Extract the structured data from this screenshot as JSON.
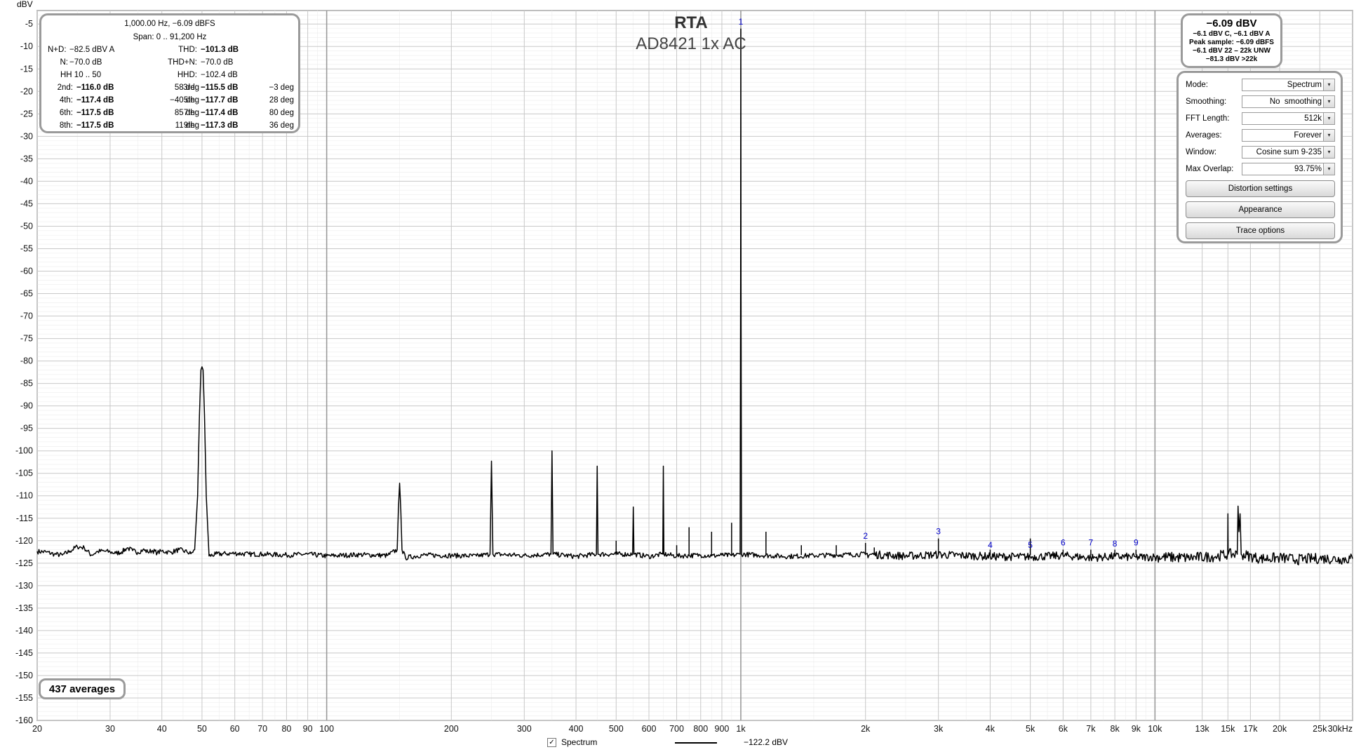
{
  "chart_data": {
    "type": "line",
    "title": "RTA",
    "subtitle": "AD8421 1x AC",
    "ylabel": "dBV",
    "xscale": "log",
    "xlim": [
      20,
      30000
    ],
    "ylim": [
      -160,
      -2
    ],
    "y_ticks": [
      -5,
      -10,
      -15,
      -20,
      -25,
      -30,
      -35,
      -40,
      -45,
      -50,
      -55,
      -60,
      -65,
      -70,
      -75,
      -80,
      -85,
      -90,
      -95,
      -100,
      -105,
      -110,
      -115,
      -120,
      -125,
      -130,
      -135,
      -140,
      -145,
      -150,
      -155,
      -160
    ],
    "x_ticks": [
      {
        "v": 20,
        "label": "20"
      },
      {
        "v": 30,
        "label": "30"
      },
      {
        "v": 40,
        "label": "40"
      },
      {
        "v": 50,
        "label": "50"
      },
      {
        "v": 60,
        "label": "60"
      },
      {
        "v": 70,
        "label": "70"
      },
      {
        "v": 80,
        "label": "80"
      },
      {
        "v": 90,
        "label": "90"
      },
      {
        "v": 100,
        "label": "100"
      },
      {
        "v": 200,
        "label": "200"
      },
      {
        "v": 300,
        "label": "300"
      },
      {
        "v": 400,
        "label": "400"
      },
      {
        "v": 500,
        "label": "500"
      },
      {
        "v": 600,
        "label": "600"
      },
      {
        "v": 700,
        "label": "700"
      },
      {
        "v": 800,
        "label": "800"
      },
      {
        "v": 900,
        "label": "900"
      },
      {
        "v": 1000,
        "label": "1k"
      },
      {
        "v": 2000,
        "label": "2k"
      },
      {
        "v": 3000,
        "label": "3k"
      },
      {
        "v": 4000,
        "label": "4k"
      },
      {
        "v": 5000,
        "label": "5k"
      },
      {
        "v": 6000,
        "label": "6k"
      },
      {
        "v": 7000,
        "label": "7k"
      },
      {
        "v": 8000,
        "label": "8k"
      },
      {
        "v": 9000,
        "label": "9k"
      },
      {
        "v": 10000,
        "label": "10k"
      },
      {
        "v": 13000,
        "label": "13k"
      },
      {
        "v": 15000,
        "label": "15k"
      },
      {
        "v": 17000,
        "label": "17k"
      },
      {
        "v": 20000,
        "label": "20k"
      },
      {
        "v": 25000,
        "label": "25k"
      },
      {
        "v": 30000,
        "label": "30kHz"
      }
    ],
    "grid": true,
    "noise_floor_dbv": -123.2,
    "series": [
      {
        "name": "Spectrum",
        "color": "#000000",
        "points": [
          [
            20,
            -122.4
          ],
          [
            21,
            -122.5
          ],
          [
            22,
            -123.0
          ],
          [
            23,
            -123.2
          ],
          [
            24,
            -122.3
          ],
          [
            25,
            -121.3
          ],
          [
            26,
            -121.6
          ],
          [
            27,
            -123.2
          ],
          [
            28,
            -122.4
          ],
          [
            29,
            -122.3
          ],
          [
            30,
            -122.5
          ],
          [
            31,
            -122.8
          ],
          [
            32,
            -122.5
          ],
          [
            33,
            -121.6
          ],
          [
            34,
            -122.2
          ],
          [
            35,
            -122.6
          ],
          [
            36,
            -122.0
          ],
          [
            37,
            -122.5
          ],
          [
            38,
            -122.2
          ],
          [
            39,
            -122.7
          ],
          [
            40,
            -122.3
          ],
          [
            42,
            -122.6
          ],
          [
            44,
            -122.0
          ],
          [
            46,
            -122.5
          ],
          [
            47,
            -122.9
          ],
          [
            48,
            -122.0
          ],
          [
            48.8,
            -110.0
          ],
          [
            49.3,
            -92.0
          ],
          [
            49.7,
            -82.0
          ],
          [
            50.0,
            -81.3
          ],
          [
            50.3,
            -82.0
          ],
          [
            50.7,
            -92.0
          ],
          [
            51.2,
            -110.0
          ],
          [
            52,
            -123.4
          ],
          [
            54,
            -123.0
          ],
          [
            57,
            -122.9
          ],
          [
            60,
            -122.8
          ],
          [
            65,
            -123.0
          ],
          [
            70,
            -123.0
          ],
          [
            80,
            -123.2
          ],
          [
            90,
            -123.0
          ],
          [
            100,
            -123.4
          ],
          [
            120,
            -123.1
          ],
          [
            140,
            -123.3
          ],
          [
            148,
            -122.0
          ],
          [
            149,
            -113.0
          ],
          [
            150,
            -107.2
          ],
          [
            151,
            -113.0
          ],
          [
            152,
            -122.0
          ],
          [
            155,
            -123.8
          ],
          [
            170,
            -123.2
          ],
          [
            200,
            -123.3
          ],
          [
            230,
            -123.4
          ],
          [
            248,
            -123.0
          ],
          [
            250,
            -102.3
          ],
          [
            252,
            -123.0
          ],
          [
            300,
            -123.3
          ],
          [
            348,
            -123.0
          ],
          [
            350,
            -100.0
          ],
          [
            352,
            -123.0
          ],
          [
            400,
            -123.5
          ],
          [
            448,
            -123.0
          ],
          [
            450,
            -103.4
          ],
          [
            452,
            -123.0
          ],
          [
            500,
            -123.0
          ],
          [
            548,
            -123.0
          ],
          [
            550,
            -112.5
          ],
          [
            552,
            -123.0
          ],
          [
            600,
            -123.5
          ],
          [
            648,
            -123.0
          ],
          [
            650,
            -103.4
          ],
          [
            652,
            -123.0
          ],
          [
            700,
            -123.4
          ],
          [
            750,
            -123.3
          ],
          [
            800,
            -123.2
          ],
          [
            850,
            -123.4
          ],
          [
            900,
            -123.2
          ],
          [
            950,
            -123.3
          ],
          [
            996,
            -123.0
          ],
          [
            999,
            -60.0
          ],
          [
            1000,
            -6.09
          ],
          [
            1001,
            -60.0
          ],
          [
            1004,
            -123.0
          ],
          [
            1100,
            -123.2
          ],
          [
            1300,
            -123.5
          ],
          [
            1500,
            -123.3
          ],
          [
            2000,
            -123.0
          ],
          [
            2500,
            -123.4
          ],
          [
            3000,
            -123.1
          ],
          [
            4000,
            -123.5
          ],
          [
            5000,
            -123.6
          ],
          [
            6000,
            -123.3
          ],
          [
            7000,
            -123.8
          ],
          [
            8000,
            -123.5
          ],
          [
            9000,
            -123.7
          ],
          [
            10000,
            -123.6
          ],
          [
            12000,
            -123.8
          ],
          [
            14000,
            -123.5
          ],
          [
            14980,
            -123.0
          ],
          [
            15000,
            -114.0
          ],
          [
            15020,
            -123.0
          ],
          [
            15800,
            -123.0
          ],
          [
            15870,
            -112.3
          ],
          [
            15950,
            -118.0
          ],
          [
            16050,
            -114.0
          ],
          [
            16150,
            -123.0
          ],
          [
            18000,
            -124.0
          ],
          [
            20000,
            -123.8
          ],
          [
            22000,
            -124.2
          ],
          [
            25000,
            -123.9
          ],
          [
            28000,
            -124.1
          ],
          [
            30000,
            -124.0
          ]
        ],
        "spurs": [
          [
            500,
            -120.0
          ],
          [
            700,
            -121.0
          ],
          [
            750,
            -117.0
          ],
          [
            850,
            -118.0
          ],
          [
            950,
            -116.0
          ],
          [
            1150,
            -118.0
          ],
          [
            1400,
            -121.0
          ],
          [
            1700,
            -121.0
          ],
          [
            2000,
            -120.5
          ],
          [
            2100,
            -121.5
          ],
          [
            3000,
            -119.5
          ],
          [
            4000,
            -122.0
          ],
          [
            5000,
            -119.5
          ],
          [
            6000,
            -122.0
          ],
          [
            7000,
            -122.0
          ],
          [
            8000,
            -122.0
          ],
          [
            9000,
            -122.0
          ]
        ]
      }
    ],
    "harmonic_markers": [
      {
        "label": "1",
        "x": 1000,
        "y": -6.09
      },
      {
        "label": "2",
        "x": 2000,
        "y": -120.5
      },
      {
        "label": "3",
        "x": 3000,
        "y": -119.5
      },
      {
        "label": "4",
        "x": 4000,
        "y": -122.5
      },
      {
        "label": "5",
        "x": 5000,
        "y": -122.5
      },
      {
        "label": "6",
        "x": 6000,
        "y": -122.0
      },
      {
        "label": "7",
        "x": 7000,
        "y": -122.0
      },
      {
        "label": "8",
        "x": 8000,
        "y": -122.2
      },
      {
        "label": "9",
        "x": 9000,
        "y": -122.0
      }
    ]
  },
  "distortion": {
    "header": "1,000.00 Hz, −6.09 dBFS",
    "span": "Span: 0 .. 91,200 Hz",
    "nd_label": "N+D:",
    "nd_value": "−82.5 dBV A",
    "thd_label": "THD:",
    "thd_value": "−101.3 dB",
    "n_label": "N:",
    "n_value": "−70.0 dB",
    "thdn_label": "THD+N:",
    "thdn_value": "−70.0 dB",
    "hh": "HH 10 .. 50",
    "hhd_label": "HHD:",
    "hhd_value": "−102.4 dB",
    "rows": [
      {
        "l1": "2nd:",
        "v1": "−116.0 dB",
        "d1": "58 deg",
        "l2": "3rd:",
        "v2": "−115.5 dB",
        "d2": "−3 deg"
      },
      {
        "l1": "4th:",
        "v1": "−117.4 dB",
        "d1": "−40 deg",
        "l2": "5th:",
        "v2": "−117.7 dB",
        "d2": "28 deg"
      },
      {
        "l1": "6th:",
        "v1": "−117.5 dB",
        "d1": "85 deg",
        "l2": "7th:",
        "v2": "−117.4 dB",
        "d2": "80 deg"
      },
      {
        "l1": "8th:",
        "v1": "−117.5 dB",
        "d1": "11 deg",
        "l2": "9th:",
        "v2": "−117.3 dB",
        "d2": "36 deg"
      }
    ]
  },
  "level": {
    "main": "−6.09 dBV",
    "l1": "−6.1 dBV C, −6.1 dBV A",
    "l2": "Peak sample: −6.09 dBFS",
    "l3": "−6.1 dBV 22 – 22k UNW",
    "l4": "−81.3 dBV >22k"
  },
  "controls": {
    "mode_label": "Mode:",
    "mode_value": "Spectrum",
    "smoothing_label": "Smoothing:",
    "smoothing_value": "No  smoothing",
    "fft_label": "FFT Length:",
    "fft_value": "512k",
    "averages_label": "Averages:",
    "averages_value": "Forever",
    "window_label": "Window:",
    "window_value": "Cosine sum 9-235",
    "overlap_label": "Max Overlap:",
    "overlap_value": "93.75%",
    "btn_distortion": "Distortion settings",
    "btn_appearance": "Appearance",
    "btn_trace": "Trace options",
    "dropdown_glyph": "▾"
  },
  "averages_badge": "437 averages",
  "legend": {
    "check": "✓",
    "name": "Spectrum",
    "value": "−122.2 dBV"
  },
  "colors": {
    "trace": "#000000",
    "marker": "#0000cc",
    "grid_major": "#c8c8c8",
    "grid_minor": "#ececec",
    "decade": "#9a9a9a",
    "panel_border": "#9a9a9a"
  }
}
